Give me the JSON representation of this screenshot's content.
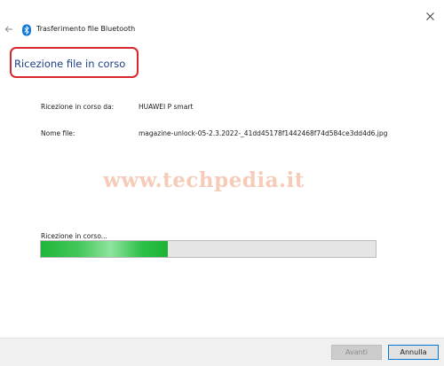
{
  "window": {
    "title": "Trasferimento file Bluetooth",
    "back_icon": "arrow-left-icon",
    "app_icon": "bluetooth-icon",
    "close_icon": "close-icon"
  },
  "main": {
    "heading": "Ricezione file in corso",
    "fields": [
      {
        "label": "Ricezione in corso da:",
        "value": "HUAWEI P smart"
      },
      {
        "label": "Nome file:",
        "value": "magazine-unlock-05-2.3.2022-_41dd45178f1442468f74d584ce3dd4d6.jpg"
      }
    ]
  },
  "watermark": "www.techpedia.it",
  "progress": {
    "label": "Ricezione in corso...",
    "fraction": 0.38,
    "color": "#2cbf47"
  },
  "footer": {
    "next_label": "Avanti",
    "cancel_label": "Annulla"
  },
  "colors": {
    "heading": "#1e3d86",
    "highlight_border": "#d8262d",
    "bluetooth": "#0a78d4",
    "focus_border": "#0078d7"
  }
}
